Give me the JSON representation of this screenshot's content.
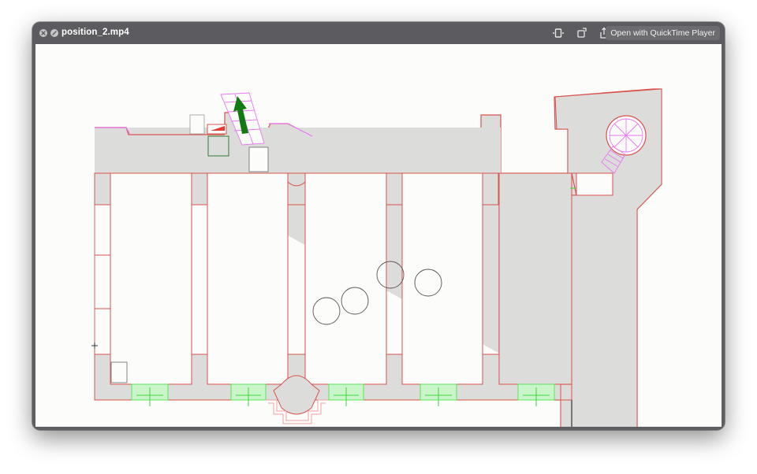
{
  "window": {
    "title": "position_2.mp4",
    "open_button_label": "Open with QuickTime Player"
  },
  "icons": {
    "close": "close-icon",
    "minimize": "minimize-icon",
    "trim": "trim-icon",
    "rotate": "rotate-icon",
    "share": "share-icon"
  },
  "colors": {
    "floor_fill": "#dcdcda",
    "wall_line": "#d9534f",
    "stairs": "#e879f0",
    "window_green": "#5ce65c",
    "arrow": "#127a12"
  }
}
